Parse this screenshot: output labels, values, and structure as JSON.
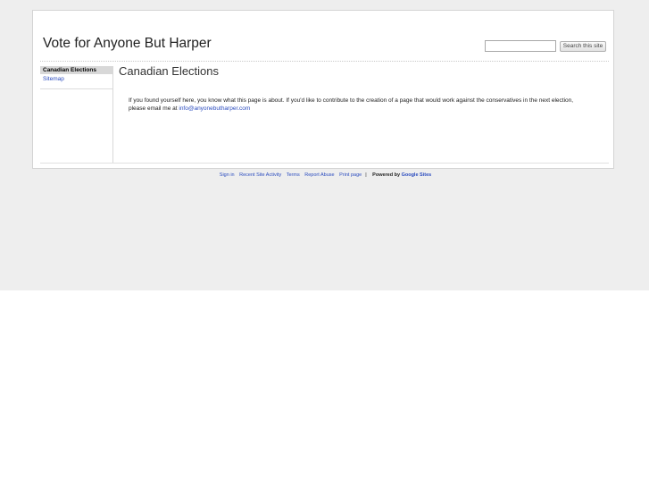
{
  "header": {
    "site_title": "Vote for Anyone But Harper",
    "search_placeholder": "",
    "search_button": "Search this site"
  },
  "sidebar": {
    "items": [
      {
        "label": "Canadian Elections"
      },
      {
        "label": "Sitemap"
      }
    ]
  },
  "content": {
    "page_title": "Canadian Elections",
    "body_text": "If you found yourself here, you know what this page is about. If you'd like to contribute to the creation of a page that would work against the conservatives in the next election, please email me at ",
    "email": "info@anyonebutharper.com"
  },
  "footer": {
    "links": [
      "Sign in",
      "Recent Site Activity",
      "Terms",
      "Report Abuse",
      "Print page"
    ],
    "separator": "|",
    "powered_by": "Powered by",
    "google_sites": "Google Sites"
  },
  "colors": {
    "link": "#2b4cbf",
    "background_band": "#eeeeee",
    "active_nav": "#d8d8d8"
  }
}
